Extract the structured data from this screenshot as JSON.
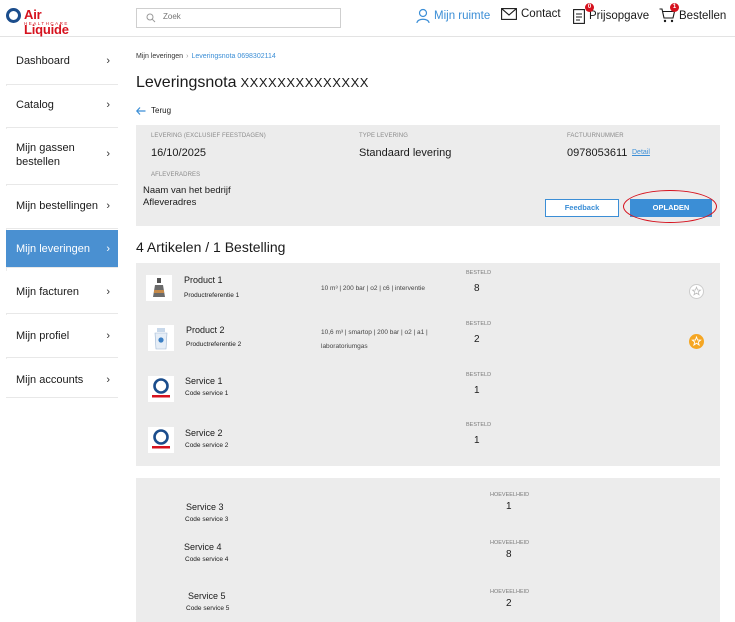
{
  "header": {
    "logo_text": "Air Liquide",
    "logo_sub": "HEALTHCARE",
    "search_placeholder": "Zoek",
    "nav": {
      "mijn_ruimte": "Mijn ruimte",
      "contact": "Contact",
      "prijsopgave": "Prijsopgave",
      "prijsopgave_badge": "0",
      "bestellen": "Bestellen",
      "bestellen_badge": "1"
    }
  },
  "sidebar": {
    "items": [
      {
        "label": "Dashboard"
      },
      {
        "label": "Catalog"
      },
      {
        "label": "Mijn gassen bestellen"
      },
      {
        "label": "Mijn bestellingen"
      },
      {
        "label": "Mijn leveringen",
        "active": true
      },
      {
        "label": "Mijn facturen"
      },
      {
        "label": "Mijn profiel"
      },
      {
        "label": "Mijn accounts"
      }
    ]
  },
  "breadcrumb": {
    "root": "Mijn leveringen",
    "current": "Leveringsnota 0698302114"
  },
  "page": {
    "title": "Leveringsnota",
    "title_number": "XXXXXXXXXXXXXX",
    "back_label": "Terug"
  },
  "info": {
    "levering_label": "LEVERING (EXCLUSIEF FEESTDAGEN)",
    "levering_value": "16/10/2025",
    "type_label": "TYPE LEVERING",
    "type_value": "Standaard levering",
    "factuur_label": "FACTUURNUMMER",
    "factuur_value": "0978053611",
    "detail_link": "Detail",
    "afleveradres_label": "AFLEVERADRES",
    "company": "Naam van het bedrijf",
    "address": "Afleveradres",
    "feedback_button": "Feedback",
    "opladen_button": "OPLADEN"
  },
  "articles": {
    "section_title": "4 Artikelen / 1 Bestelling",
    "items": [
      {
        "name": "Product 1",
        "ref": "Productreferentie 1",
        "spec": "10 m³ | 200 bar | o2 | c6 | interventie",
        "qty_label": "BESTELD",
        "qty": "8",
        "starred": false
      },
      {
        "name": "Product 2",
        "ref": "Productreferentie 2",
        "spec": "10,6 m³ | smartop | 200 bar | o2 | a1 | laboratoriumgas",
        "qty_label": "BESTELD",
        "qty": "2",
        "starred": true
      },
      {
        "name": "Service 1",
        "ref": "Code service 1",
        "qty_label": "BESTELD",
        "qty": "1"
      },
      {
        "name": "Service 2",
        "ref": "Code service 2",
        "qty_label": "BESTELD",
        "qty": "1"
      }
    ]
  },
  "services": {
    "items": [
      {
        "name": "Service 3",
        "ref": "Code service 3",
        "qty_label": "HOEVEELHEID",
        "qty": "1"
      },
      {
        "name": "Service 4",
        "ref": "Code service 4",
        "qty_label": "HOEVEELHEID",
        "qty": "8"
      },
      {
        "name": "Service 5",
        "ref": "Code service 5",
        "qty_label": "HOEVEELHEID",
        "qty": "2"
      }
    ]
  },
  "colors": {
    "accent": "#3b8ed6",
    "active_nav": "#4a90d1",
    "brand_red": "#d6121e",
    "star_active": "#f5a623"
  }
}
